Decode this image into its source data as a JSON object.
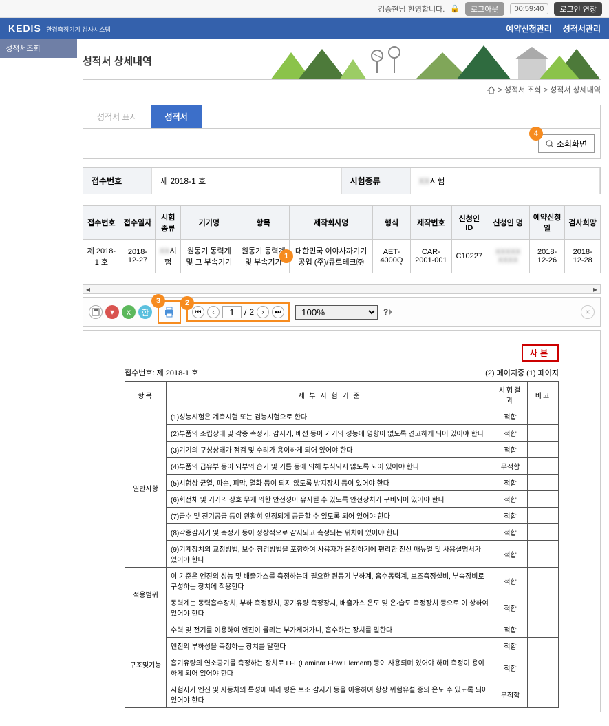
{
  "topbar": {
    "welcome": "김승현님 환영합니다.",
    "logout": "로그아웃",
    "timer": "00:59:40",
    "extend": "로그인 연장"
  },
  "header": {
    "logo": "KEDIS",
    "logo_sub": "환경측정기기 검사시스템",
    "nav": [
      "예약신청관리",
      "성적서관리"
    ]
  },
  "sidebar": {
    "item1": "성적서조회"
  },
  "page": {
    "title": "성적서 상세내역",
    "crumb": [
      "성적서 조회",
      "성적서 상세내역"
    ]
  },
  "tabs": {
    "tab1": "성적서 표지",
    "tab2": "성적서"
  },
  "toolbar": {
    "search": "조회화면"
  },
  "info": {
    "h1": "접수번호",
    "v1": "제 2018-1 호",
    "h2": "시험종류",
    "v2_pre": "",
    "v2_post": "시험"
  },
  "table": {
    "headers": [
      "접수번호",
      "접수일자",
      "시험종류",
      "기기명",
      "항목",
      "제작회사명",
      "형식",
      "제작번호",
      "신청인 ID",
      "신청인 명",
      "예약신청일",
      "검사희망"
    ],
    "row": {
      "c0": "제 2018-1 호",
      "c1": "2018-12-27",
      "c2_pre": "",
      "c2_post": "시험",
      "c3": "원동기 동력계 및 그 부속기기",
      "c4": "원동기 동력계 및 부속기기",
      "c5": "대한민국 이야사까기기공업 (주)/큐로테크㈜",
      "c6": "AET-4000Q",
      "c7": "CAR-2001-001",
      "c8": "C10227",
      "c9": "",
      "c10": "2018-12-26",
      "c11": "2018-12-28"
    }
  },
  "callouts": {
    "c1": "1",
    "c2": "2",
    "c3": "3",
    "c4": "4"
  },
  "rt": {
    "page_cur": "1",
    "page_sep": "/",
    "page_total": "2",
    "zoom": "100%"
  },
  "doc": {
    "stamp": "사본",
    "recv_no": "접수번호:   제 2018-1 호",
    "page_info": "(2) 페이지중 (1) 페이지",
    "h_item": "항목",
    "h_std": "세   부   시   험   기   준",
    "h_res": "시험결과",
    "h_note": "비고",
    "g1": "일반사항",
    "r1": "(1)성능시험은 계측시험 또는 검능시험으로 한다",
    "r2": "(2)부품의 조립상태 및 각종 측정기, 감지기, 배선 등이 기기의 성능에 영향이 없도록 견고하게 되어 있어야 한다",
    "r3": "(3)기기의 구성상태가 점검 및 수리가 용이하게 되어 있어야 한다",
    "r4": "(4)부품의 급유부 등이 외부의 습기 및 기름 등에 의해 부식되지 않도록 되어 있어야 한다",
    "r5": "(5)시험상 균열, 파손, 피막, 열화 등이 되지 않도록 방지장치 등이 있어야 한다",
    "r6": "(6)회전체 및 기기의 상호 무게 의한 안전성이 유지될 수 있도록 안전장치가 구비되어 있어야 한다",
    "r7": "(7)급수 및 전기공급 등이 원활히 안정되게 공급할 수 있도록 되어 있어야 한다",
    "r8": "(8)각종감지기 및 측정기 등이 정상적으로 감지되고 측정되는 위치에 있어야 한다",
    "r9": "(9)기계장치의 교정방법, 보수·점검방법을 포함하여 사용자가 운전하기에 편리한 전산 매뉴얼 및 사용설명서가 있어야 한다",
    "g2": "적용범위",
    "r10": "이 기준은 엔진의 성능 및 배출가스를 측정하는데 필요한 원동기 부하계, 흡수동력계, 보조측정설비, 부속장비로 구성하는 장치에 적용한다",
    "r11": "동력계는 동력흡수장치, 부하 측정장치, 공기유량 측정장치, 배출가스 온도 및 온·습도 측정장치 등으로 이 상하여 있어야 한다",
    "r12": "수력 및 전기를 이용하여 엔진이 물리는 부가케어가니, 흡수하는 장치를 말한다",
    "r13": "엔진의 부하성을 측정하는 장치를 말한다",
    "g3": "구조및기능",
    "r14": "흡기유량의 연소공기를 측정하는 장치로 LFE(Laminar Flow Element) 등이 사용되며 있어야 하며 측정이 용이하게 되어 있어야 한다",
    "r15": "시험자가 엔진 및 자동차의 특성에 따라 평온 보조 감지기 등을 이용하여 항상 위험유설 중의 온도 수 있도록 되어 있어야 한다",
    "res_ok": "적합",
    "res_na": "무적합"
  }
}
